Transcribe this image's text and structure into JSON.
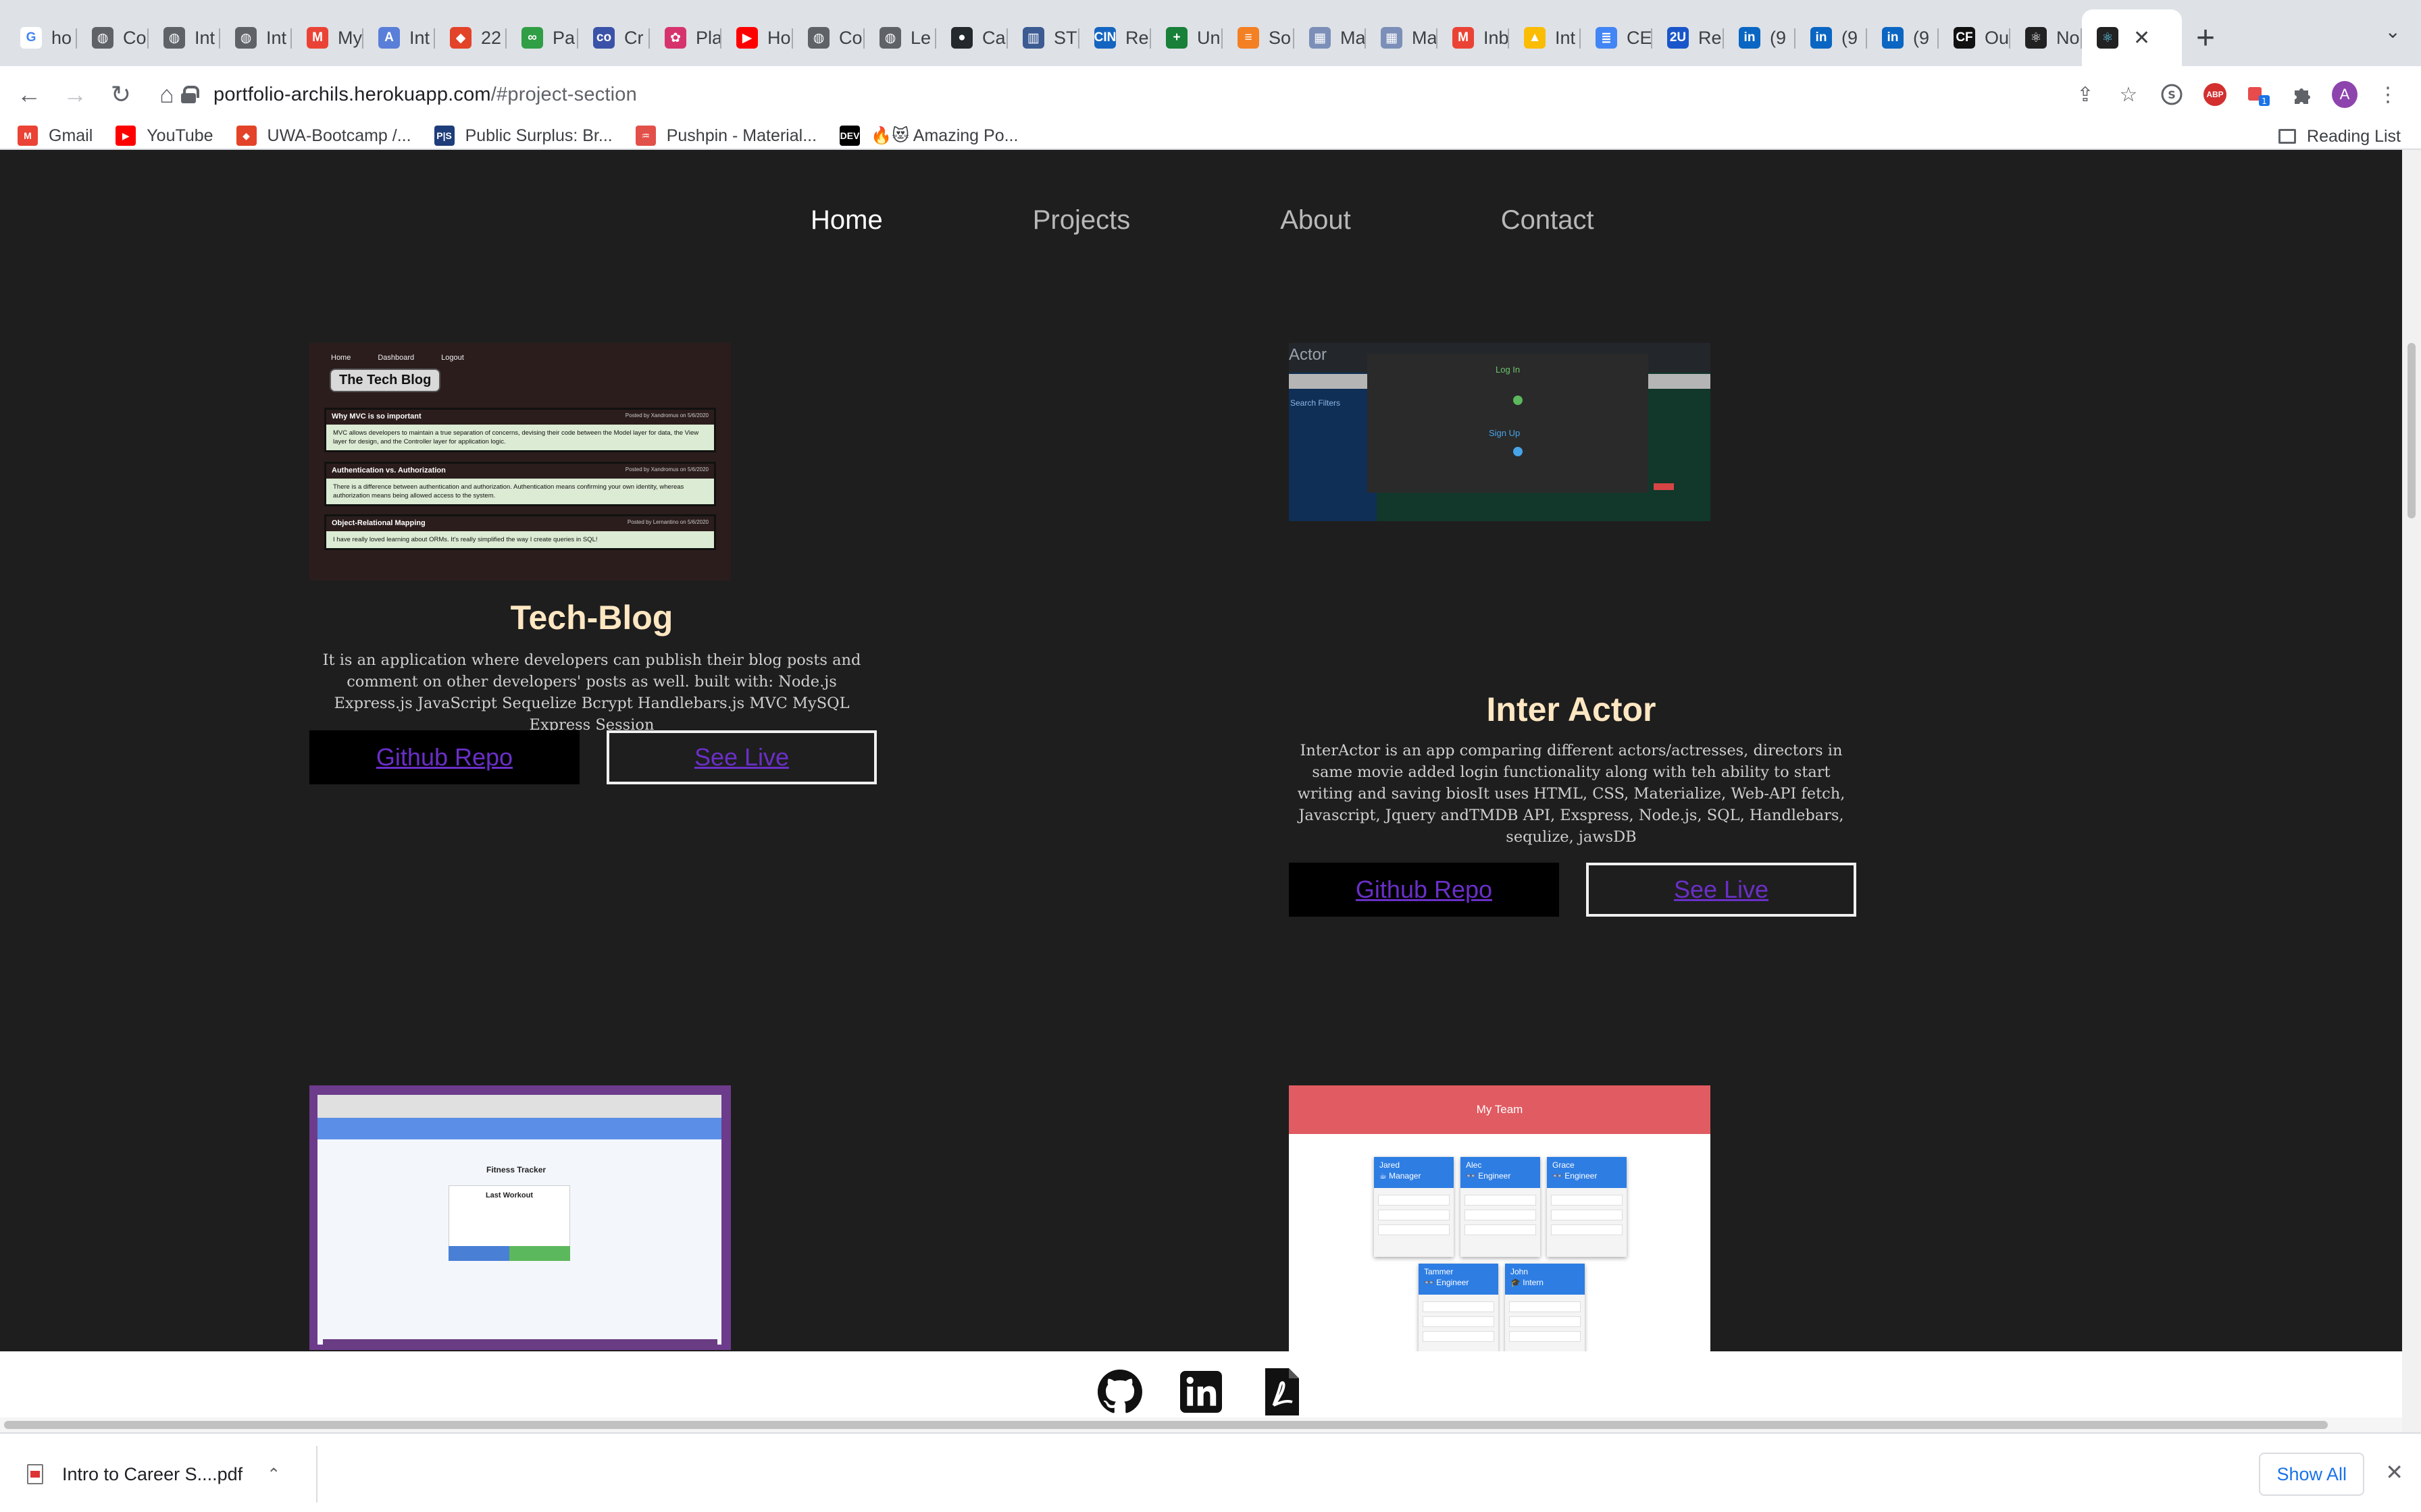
{
  "browser": {
    "tabs": [
      {
        "label": "ho",
        "favicon": "google",
        "color": "#ffffff"
      },
      {
        "label": "Co",
        "favicon": "globe",
        "color": "#5f6368"
      },
      {
        "label": "Int",
        "favicon": "globe",
        "color": "#5f6368"
      },
      {
        "label": "Int",
        "favicon": "globe",
        "color": "#5f6368"
      },
      {
        "label": "My",
        "favicon": "gmail",
        "color": "#ea4335"
      },
      {
        "label": "Int",
        "favicon": "a-letter",
        "color": "#5a7fd8"
      },
      {
        "label": "22",
        "favicon": "gitlab",
        "color": "#e24329"
      },
      {
        "label": "Pa",
        "favicon": "link",
        "color": "#2f9e44"
      },
      {
        "label": "Cr",
        "favicon": "co",
        "color": "#3a52a8"
      },
      {
        "label": "Pla",
        "favicon": "flower",
        "color": "#d6336c"
      },
      {
        "label": "Ho",
        "favicon": "youtube",
        "color": "#ff0000"
      },
      {
        "label": "Co",
        "favicon": "globe",
        "color": "#5f6368"
      },
      {
        "label": "Le",
        "favicon": "globe",
        "color": "#5f6368"
      },
      {
        "label": "Ca",
        "favicon": "github",
        "color": "#24292e"
      },
      {
        "label": "ST",
        "favicon": "stats",
        "color": "#3b5b92"
      },
      {
        "label": "Re",
        "favicon": "cin",
        "color": "#1565c0"
      },
      {
        "label": "Un",
        "favicon": "sheets",
        "color": "#188038"
      },
      {
        "label": "So",
        "favicon": "stack",
        "color": "#f48024"
      },
      {
        "label": "Ma",
        "favicon": "grid",
        "color": "#7b8fb8"
      },
      {
        "label": "Ma",
        "favicon": "grid",
        "color": "#7b8fb8"
      },
      {
        "label": "Inb",
        "favicon": "gmail",
        "color": "#ea4335"
      },
      {
        "label": "Int",
        "favicon": "drive",
        "color": "#fbbc04"
      },
      {
        "label": "CE",
        "favicon": "docs",
        "color": "#4285f4"
      },
      {
        "label": "Re",
        "favicon": "2u",
        "color": "#1a56c9"
      },
      {
        "label": "(9",
        "favicon": "linkedin",
        "color": "#0a66c2"
      },
      {
        "label": "(9",
        "favicon": "linkedin",
        "color": "#0a66c2"
      },
      {
        "label": "(9",
        "favicon": "linkedin",
        "color": "#0a66c2"
      },
      {
        "label": "Ou",
        "favicon": "cf",
        "color": "#111111"
      },
      {
        "label": "No",
        "favicon": "react",
        "color": "#222222"
      }
    ],
    "active_tab_favicon": "react",
    "url_host": "portfolio-archils.herokuapp.com",
    "url_path": "/#project-section",
    "bookmarks": [
      {
        "label": "Gmail",
        "favicon": "gmail",
        "color": "#ea4335"
      },
      {
        "label": "YouTube",
        "favicon": "youtube",
        "color": "#ff0000"
      },
      {
        "label": "UWA-Bootcamp /...",
        "favicon": "gitlab",
        "color": "#e24329"
      },
      {
        "label": "Public Surplus: Br...",
        "favicon": "ps",
        "color": "#1f3d7a"
      },
      {
        "label": "Pushpin - Material...",
        "favicon": "pushpin",
        "color": "#e2504a"
      },
      {
        "label": "🔥😻 Amazing Po...",
        "favicon": "dev",
        "color": "#000000"
      }
    ],
    "reading_list": "Reading List",
    "avatar_letter": "A"
  },
  "site": {
    "nav": [
      {
        "label": "Home",
        "active": true
      },
      {
        "label": "Projects",
        "active": false
      },
      {
        "label": "About",
        "active": false
      },
      {
        "label": "Contact",
        "active": false
      }
    ],
    "projects": [
      {
        "title": "Tech-Blog",
        "description": "It is an application where developers can publish their blog posts and comment on other developers' posts as well. built with: Node.js Express.js JavaScript Sequelize Bcrypt Handlebars.js MVC MySQL Express Session",
        "repo_label": "Github Repo",
        "live_label": "See Live",
        "screenshot": {
          "nav": [
            "Home",
            "Dashboard",
            "Logout"
          ],
          "logo": "The Tech Blog",
          "posts": [
            {
              "title": "Why MVC is so important",
              "meta": "Posted by Xandromus on 5/6/2020",
              "body": "MVC allows developers to maintain a true separation of concerns, devising their code between the Model layer for data, the View layer for design, and the Controller layer for application logic."
            },
            {
              "title": "Authentication vs. Authorization",
              "meta": "Posted by Xandromus on 5/6/2020",
              "body": "There is a difference between authentication and authorization. Authentication means confirming your own identity, whereas authorization means being allowed access to the system."
            },
            {
              "title": "Object-Relational Mapping",
              "meta": "Posted by Lernantino on 5/6/2020",
              "body": "I have really loved learning about ORMs. It's really simplified the way I create queries in SQL!"
            }
          ]
        }
      },
      {
        "title": "Inter Actor",
        "description": "InterActor is an app comparing different actors/actresses, directors in same movie added login functionality along with teh ability to start writing and saving biosIt uses HTML, CSS, Materialize, Web-API fetch, Javascript, Jquery andTMDB API, Exspress, Node.js, SQL, Handlebars, sequlize, jawsDB",
        "repo_label": "Github Repo",
        "live_label": "See Live",
        "screenshot": {
          "title": "Actor",
          "filter": "Search Filters",
          "login": "Log In",
          "signup": "Sign Up"
        }
      },
      {
        "title": "",
        "screenshot": {
          "heading": "Fitness Tracker",
          "card_title": "Last Workout"
        }
      },
      {
        "title": "",
        "screenshot": {
          "header": "My Team",
          "members": [
            {
              "name": "Jared",
              "role": "☕ Manager"
            },
            {
              "name": "Alec",
              "role": "👓 Engineer"
            },
            {
              "name": "Grace",
              "role": "👓 Engineer"
            },
            {
              "name": "Tammer",
              "role": "👓 Engineer"
            },
            {
              "name": "John",
              "role": "🎓 Intern"
            }
          ]
        }
      }
    ],
    "footer_icons": [
      "github-icon",
      "linkedin-icon",
      "pdf-icon"
    ]
  },
  "downloads": {
    "file": "Intro to Career S....pdf",
    "show_all": "Show All"
  }
}
